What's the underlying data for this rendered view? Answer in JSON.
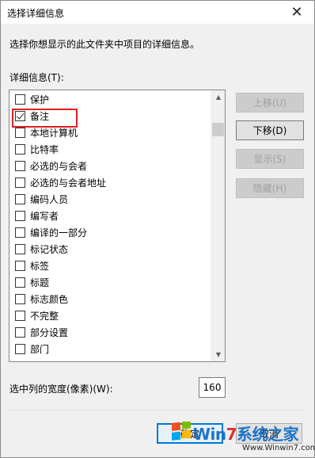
{
  "window": {
    "title": "选择详细信息",
    "close_glyph": "✕"
  },
  "description": "选择你想显示的此文件夹中项目的详细信息。",
  "list_label": "详细信息(T):",
  "items": [
    {
      "label": "保护",
      "checked": false
    },
    {
      "label": "备注",
      "checked": true
    },
    {
      "label": "本地计算机",
      "checked": false
    },
    {
      "label": "比特率",
      "checked": false
    },
    {
      "label": "必选的与会者",
      "checked": false
    },
    {
      "label": "必选的与会者地址",
      "checked": false
    },
    {
      "label": "编码人员",
      "checked": false
    },
    {
      "label": "编写者",
      "checked": false
    },
    {
      "label": "编译的一部分",
      "checked": false
    },
    {
      "label": "标记状态",
      "checked": false
    },
    {
      "label": "标签",
      "checked": false
    },
    {
      "label": "标题",
      "checked": false
    },
    {
      "label": "标志颜色",
      "checked": false
    },
    {
      "label": "不完整",
      "checked": false
    },
    {
      "label": "部分设置",
      "checked": false
    },
    {
      "label": "部门",
      "checked": false
    }
  ],
  "buttons": {
    "move_up": "上移(U)",
    "move_down": "下移(D)",
    "show": "显示(S)",
    "hide": "隐藏(H)",
    "ok": "确定",
    "cancel": "取消"
  },
  "width": {
    "label": "选中列的宽度(像素)(W):",
    "value": "160"
  },
  "watermark": {
    "brand_prefix": "Win",
    "brand_seven": "7",
    "brand_suffix": "系统之家",
    "site": "Www.Winwin7.com"
  },
  "colors": {
    "highlight": "#e02020",
    "accent": "#0078d7"
  }
}
